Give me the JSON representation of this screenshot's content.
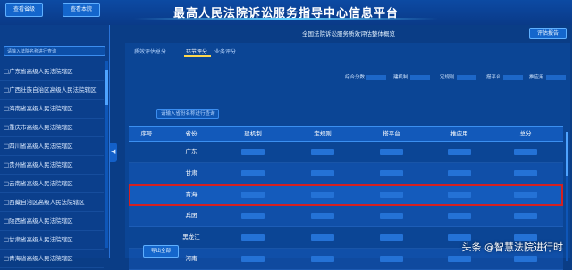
{
  "header": {
    "title": "最高人民法院诉讼服务指导中心信息平台",
    "btn_query_a": "查看省级",
    "btn_query_b": "查看本院"
  },
  "sidebar": {
    "search_placeholder": "请输入法院名称进行查询",
    "items": [
      "□广东省高级人民法院辖区",
      "□广西壮族自治区高级人民法院辖区",
      "□海南省高级人民法院辖区",
      "□重庆市高级人民法院辖区",
      "□四川省高级人民法院辖区",
      "□贵州省高级人民法院辖区",
      "□云南省高级人民法院辖区",
      "□西藏自治区高级人民法院辖区",
      "□陕西省高级人民法院辖区",
      "□甘肃省高级人民法院辖区",
      "□青海省高级人民法院辖区"
    ]
  },
  "panel": {
    "subtitle": "全国法院诉讼服务质效评估整体概览",
    "export_report": "评估报告",
    "tabs": [
      "质效评估总分",
      "环节评分",
      "业务评分"
    ],
    "summary": [
      "综合分数",
      "建机制",
      "定规则",
      "搭平台",
      "推应用"
    ],
    "table_search_placeholder": "请输入省份名称进行查询",
    "columns": [
      "序号",
      "省份",
      "建机制",
      "定规则",
      "搭平台",
      "推应用",
      "总分"
    ],
    "rows": [
      {
        "province": "广东"
      },
      {
        "province": "甘肃"
      },
      {
        "province": "青海"
      },
      {
        "province": "兵团"
      },
      {
        "province": "黑龙江"
      },
      {
        "province": "河南"
      }
    ],
    "export_all": "导出全部"
  },
  "watermark": "头条 @智慧法院进行时"
}
